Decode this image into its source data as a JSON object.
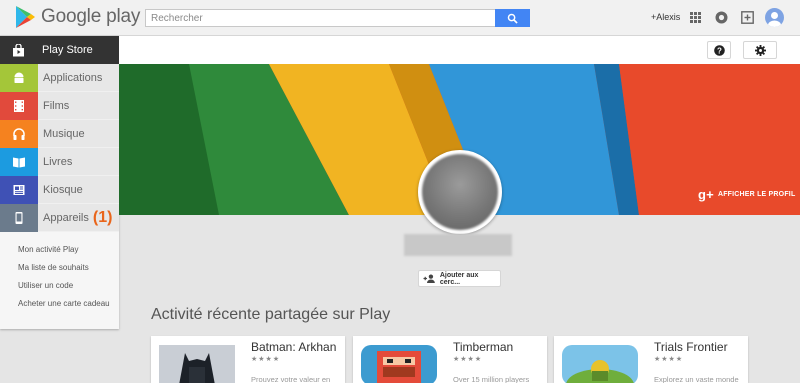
{
  "header": {
    "logo_text": "Google play",
    "search_placeholder": "Rechercher",
    "user_name": "+Alexis"
  },
  "sidebar": {
    "store_label": "Play Store",
    "items": [
      {
        "label": "Applications",
        "icon": "android-icon",
        "color": "#a4c639"
      },
      {
        "label": "Films",
        "icon": "film-icon",
        "color": "#e14a3c"
      },
      {
        "label": "Musique",
        "icon": "headphones-icon",
        "color": "#f5821f"
      },
      {
        "label": "Livres",
        "icon": "book-icon",
        "color": "#1c9be0"
      },
      {
        "label": "Kiosque",
        "icon": "newspaper-icon",
        "color": "#3f51b5"
      },
      {
        "label": "Appareils",
        "icon": "device-icon",
        "color": "#6b7b8c"
      }
    ],
    "annotation": "(1)",
    "links": [
      "Mon activité Play",
      "Ma liste de souhaits",
      "Utiliser un code",
      "Acheter une carte cadeau"
    ]
  },
  "banner": {
    "profile_link": "AFFICHER LE PROFIL"
  },
  "profile": {
    "add_circle_label": "Ajouter aux cerc..."
  },
  "activity": {
    "title": "Activité récente partagée sur Play",
    "cards": [
      {
        "title": "Batman: Arkhan",
        "stars": "★★★★",
        "desc": "Prouvez votre valeur en"
      },
      {
        "title": "Timberman",
        "stars": "★★★★",
        "desc": "Over 15 million players"
      },
      {
        "title": "Trials Frontier",
        "stars": "★★★★",
        "desc": "Explorez un vaste monde"
      }
    ]
  },
  "colors": {
    "accent": "#4285f4",
    "annotation": "#e9651b",
    "store_bar": "#333333"
  }
}
